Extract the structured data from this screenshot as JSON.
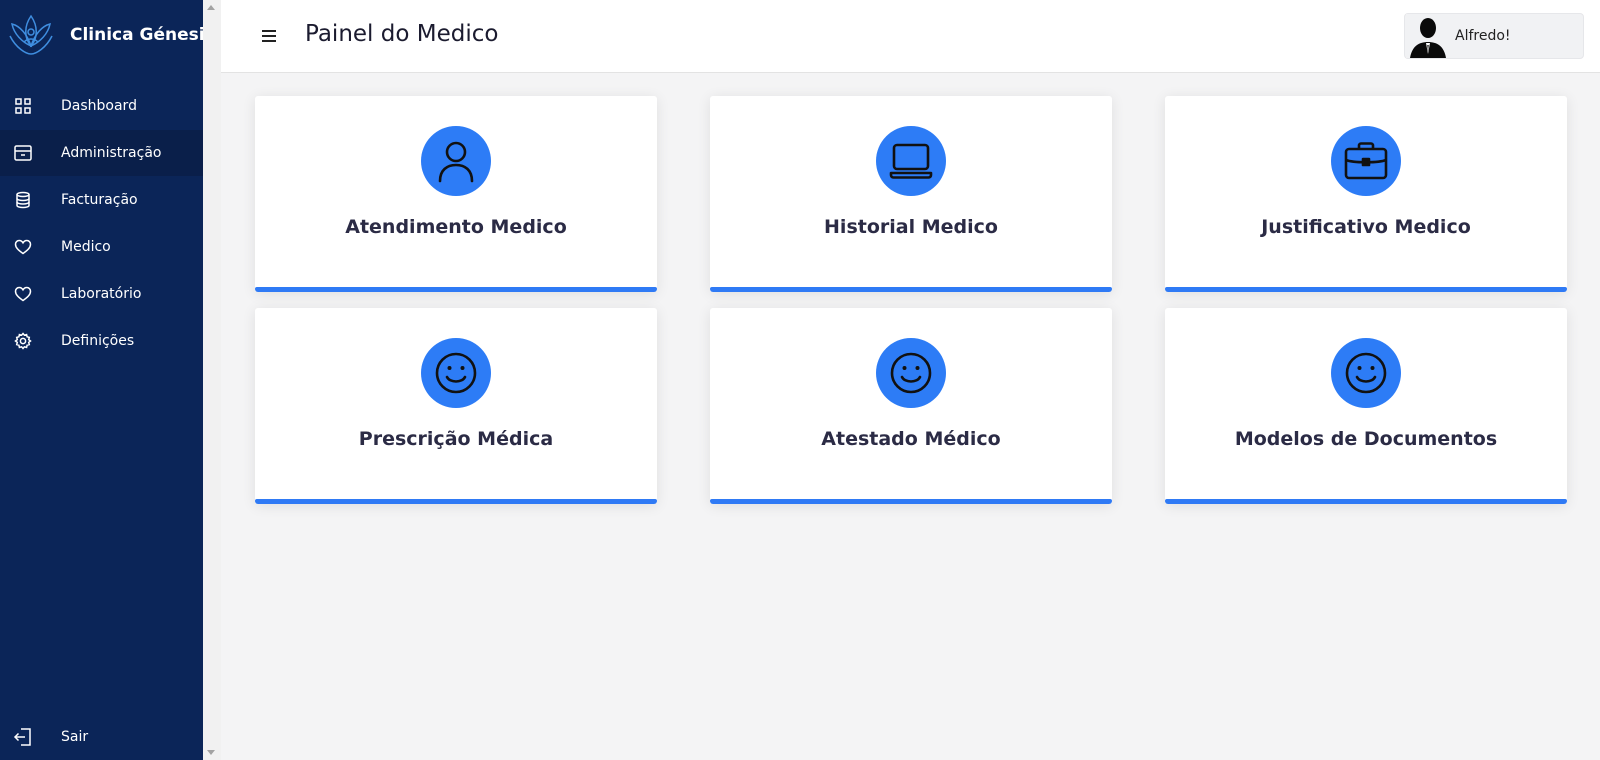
{
  "brand": {
    "name": "Clinica Génesis",
    "icon": "lotus-logo-icon"
  },
  "sidebar": {
    "items": [
      {
        "label": "Dashboard",
        "icon": "grid-icon"
      },
      {
        "label": "Administração",
        "icon": "archive-box-icon",
        "active": true
      },
      {
        "label": "Facturação",
        "icon": "database-icon"
      },
      {
        "label": "Medico",
        "icon": "heart-icon"
      },
      {
        "label": "Laboratório",
        "icon": "heart-icon"
      },
      {
        "label": "Definições",
        "icon": "gear-icon"
      }
    ],
    "logout": {
      "label": "Sair",
      "icon": "logout-icon"
    }
  },
  "header": {
    "title": "Painel do Medico",
    "menu_icon": "hamburger-menu-icon",
    "user": {
      "name": "Alfredo!",
      "avatar": "avatar-silhouette-icon"
    }
  },
  "cards": [
    {
      "title": "Atendimento Medico",
      "icon": "person-icon"
    },
    {
      "title": "Historial Medico",
      "icon": "laptop-icon"
    },
    {
      "title": "Justificativo Medico",
      "icon": "briefcase-icon"
    },
    {
      "title": "Prescrição Médica",
      "icon": "smiley-icon"
    },
    {
      "title": "Atestado Médico",
      "icon": "smiley-icon"
    },
    {
      "title": "Modelos de Documentos",
      "icon": "smiley-icon"
    }
  ],
  "colors": {
    "sidebar_bg": "#0b2558",
    "accent": "#2d7cf6",
    "page_bg": "#f4f4f5"
  }
}
